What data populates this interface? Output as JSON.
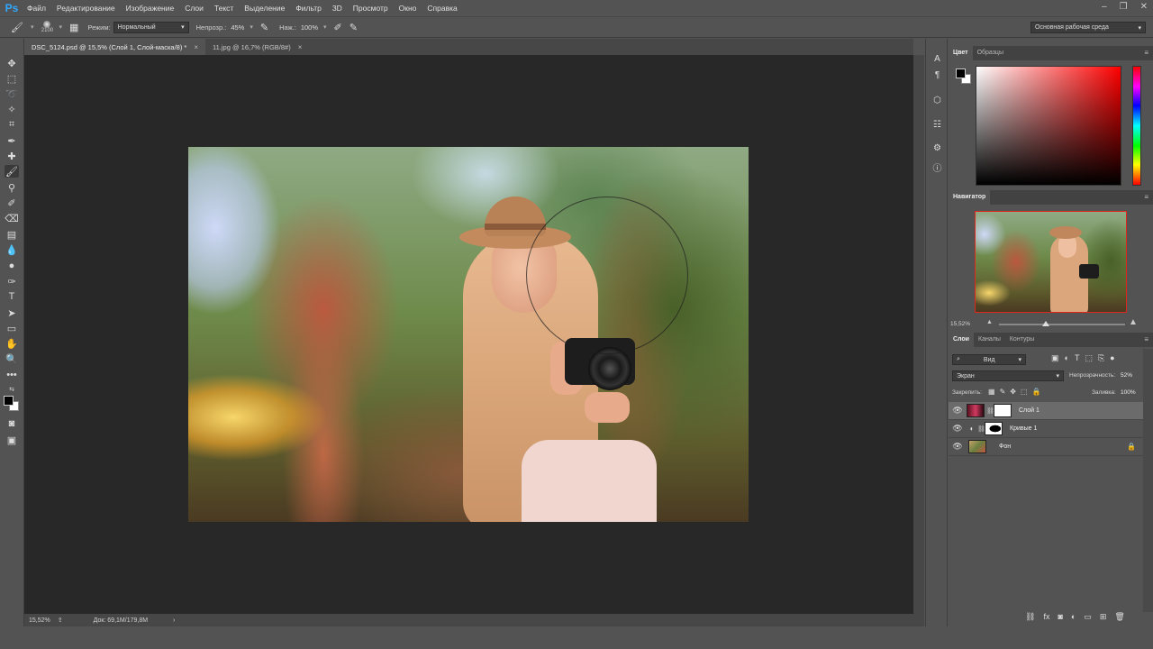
{
  "app": {
    "logo": "Ps"
  },
  "menu": [
    "Файл",
    "Редактирование",
    "Изображение",
    "Слои",
    "Текст",
    "Выделение",
    "Фильтр",
    "3D",
    "Просмотр",
    "Окно",
    "Справка"
  ],
  "window_controls": {
    "minimize": "–",
    "restore": "❐",
    "close": "✕"
  },
  "options_bar": {
    "brush_size": "2100",
    "mode_label": "Режим:",
    "mode_value": "Нормальный",
    "opacity_label": "Непрозр.:",
    "opacity_value": "45%",
    "flow_label": "Наж.:",
    "flow_value": "100%",
    "workspace": "Основная рабочая среда"
  },
  "tabs": [
    {
      "title": "DSC_5124.psd @ 15,5% (Слой 1, Слой-маска/8) *",
      "close": "×"
    },
    {
      "title": "11.jpg @ 16,7% (RGB/8#)",
      "close": "×"
    }
  ],
  "status": {
    "zoom": "15,52%",
    "doc": "Док: 69,1M/179,8M",
    "arrow": "›"
  },
  "color_panel": {
    "tab_active": "Цвет",
    "tab_other": "Образцы"
  },
  "navigator": {
    "title": "Навигатор",
    "zoom": "15,52%"
  },
  "layers_panel": {
    "tabs": [
      "Слои",
      "Каналы",
      "Контуры"
    ],
    "filter": "Вид",
    "blend": "Экран",
    "opacity_label": "Непрозрачность:",
    "opacity_value": "52%",
    "lock_label": "Закрепить:",
    "fill_label": "Заливка:",
    "fill_value": "100%",
    "layers": [
      {
        "name": "Слой 1"
      },
      {
        "name": "Кривые 1"
      },
      {
        "name": "Фон"
      }
    ]
  },
  "colors": {
    "accent": "#31a8ff",
    "nav_frame": "#e0261a"
  }
}
